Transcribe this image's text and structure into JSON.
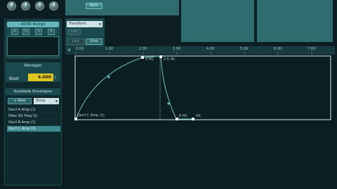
{
  "top": {
    "sync_label": "Sync",
    "knobs": [
      "knob-1",
      "knob-2",
      "knob-3",
      "knob-4"
    ]
  },
  "adsr": {
    "title": "ADSR Assign",
    "buttons": [
      "A",
      "D",
      "S",
      "R"
    ]
  },
  "retrigger": {
    "title": "Retrigger",
    "beat_label": "Beat",
    "beat_value": "4.000"
  },
  "envelopes": {
    "title": "Available Envelopes",
    "new_label": "+ New",
    "show_label": "Show",
    "items": [
      {
        "label": "Oscil A Amp (1)",
        "selected": false
      },
      {
        "label": "Filter A1 Freq (1)",
        "selected": false
      },
      {
        "label": "Oscil B Amp (1)",
        "selected": false
      },
      {
        "label": "Oscil C Amp (1)",
        "selected": true
      }
    ]
  },
  "editor": {
    "transform_label": "Transform",
    "edit_label": "Edit",
    "lock_label": "Lock",
    "slide_label": "Slide",
    "ruler_ticks": [
      "0.00",
      "1.00",
      "2.00",
      "3.00",
      "4.00",
      "5.00",
      "6.00",
      "7.00"
    ],
    "point_labels": {
      "start": "Oscil C Amp (1)",
      "peak": "3 HC",
      "curve": "2.5 HC",
      "bottom": "8 HC",
      "end": "HC"
    }
  },
  "colors": {
    "accent": "#66b8bc",
    "envelope_line": "#6fc2c0",
    "beat_field": "#e0c820",
    "selected_row": "#3c8a8e"
  }
}
